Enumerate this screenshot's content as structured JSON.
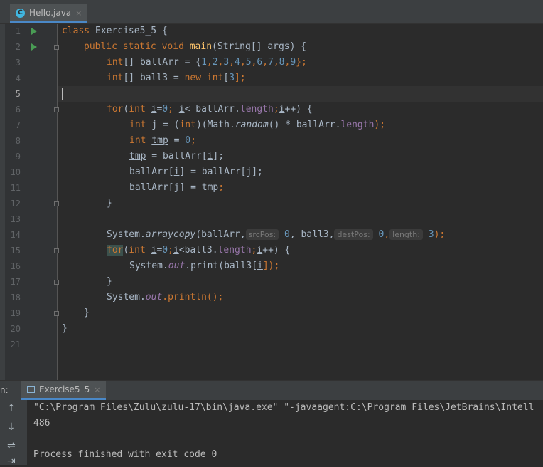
{
  "editor_tab": {
    "label": "Hello.java",
    "close": "×"
  },
  "lines": [
    {
      "n": "1"
    },
    {
      "n": "2"
    },
    {
      "n": "3"
    },
    {
      "n": "4"
    },
    {
      "n": "5"
    },
    {
      "n": "6"
    },
    {
      "n": "7"
    },
    {
      "n": "8"
    },
    {
      "n": "9"
    },
    {
      "n": "10"
    },
    {
      "n": "11"
    },
    {
      "n": "12"
    },
    {
      "n": "13"
    },
    {
      "n": "14"
    },
    {
      "n": "15"
    },
    {
      "n": "16"
    },
    {
      "n": "17"
    },
    {
      "n": "18"
    },
    {
      "n": "19"
    },
    {
      "n": "20"
    },
    {
      "n": "21"
    }
  ],
  "code": {
    "l1": [
      "class",
      " Exercise5_5 {"
    ],
    "l2": [
      "public",
      " ",
      "static",
      " ",
      "void",
      " ",
      "main",
      "(String[] args) {"
    ],
    "l3": [
      "int",
      "[] ballArr = {",
      "1",
      ",",
      "2",
      ",",
      "3",
      ",",
      "4",
      ",",
      "5",
      ",",
      "6",
      ",",
      "7",
      ",",
      "8",
      ",",
      "9",
      "};"
    ],
    "l4": [
      "int",
      "[] ball3 = ",
      "new",
      " ",
      "int",
      "[",
      "3",
      "];"
    ],
    "l6": [
      "for",
      "(",
      "int",
      " ",
      "i",
      "=",
      "0",
      "; ",
      "i",
      "< ballArr.",
      "length",
      ";",
      "i",
      "++) {"
    ],
    "l7": [
      "int",
      " j = (",
      "int",
      ")(Math.",
      "random",
      "() * ballArr.",
      "length",
      ");"
    ],
    "l8": [
      "int",
      " ",
      "tmp",
      " = ",
      "0",
      ";"
    ],
    "l9": [
      "tmp",
      " = ballArr[",
      "i",
      "];"
    ],
    "l10": [
      "ballArr[",
      "i",
      "] = ballArr[j];"
    ],
    "l11": [
      "ballArr[j] = ",
      "tmp",
      ";"
    ],
    "l12": [
      "}"
    ],
    "l14": [
      "System.",
      "arraycopy",
      "(ballArr,",
      "srcPos:",
      " ",
      "0",
      ", ball3,",
      "destPos:",
      " ",
      "0",
      ",",
      "length:",
      " ",
      "3",
      ");"
    ],
    "l15": [
      "for",
      "(",
      "int",
      " ",
      "i",
      "=",
      "0",
      ";",
      "i",
      "<ball3.",
      "length",
      ";",
      "i",
      "++) {"
    ],
    "l16": [
      "System.",
      "out",
      ".print(ball3[",
      "i",
      "]);"
    ],
    "l17": [
      "}"
    ],
    "l18": [
      "System.",
      "out",
      ".println();"
    ],
    "l19": [
      "}"
    ],
    "l20": [
      "}"
    ]
  },
  "run_panel": {
    "label": "n:",
    "tab_label": "Exercise5_5",
    "close": "×",
    "tools": [
      "↑",
      "↓",
      "⇌",
      "⇥"
    ],
    "output": [
      "\"C:\\Program Files\\Zulu\\zulu-17\\bin\\java.exe\" \"-javaagent:C:\\Program Files\\JetBrains\\Intell",
      "486",
      "",
      "Process finished with exit code 0"
    ]
  },
  "colors": {
    "keyword": "#cc7832",
    "number": "#6897bb",
    "method": "#ffc66d",
    "field": "#9876aa",
    "text": "#a9b7c6",
    "background": "#2b2b2b",
    "gutter": "#313335"
  }
}
